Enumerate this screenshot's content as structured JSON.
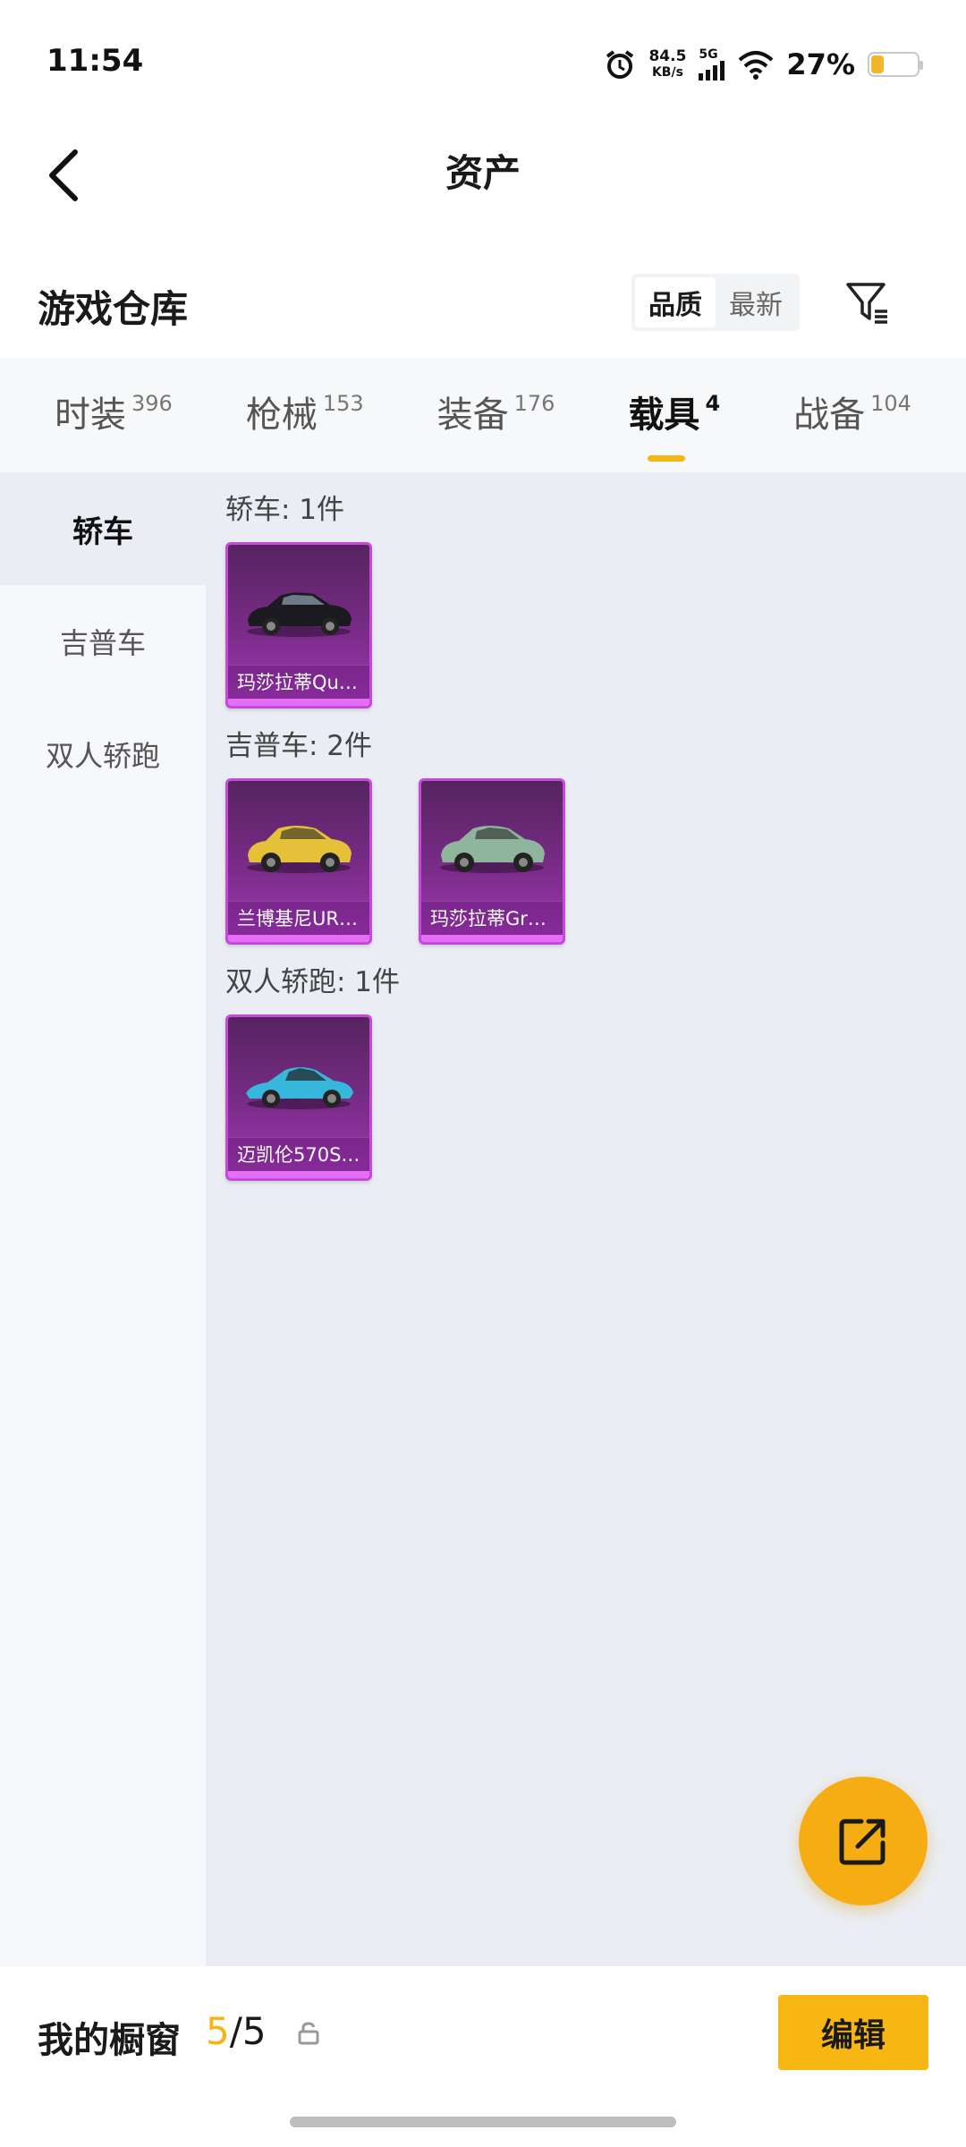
{
  "status_bar": {
    "time": "11:54",
    "speed_value": "84.5",
    "speed_unit": "KB/s",
    "network": "5G",
    "battery_percent": "27%",
    "battery_level": 0.27
  },
  "header": {
    "title": "资产"
  },
  "warehouse": {
    "title": "游戏仓库",
    "sort_options": [
      "品质",
      "最新"
    ],
    "sort_selected": "品质"
  },
  "tabs": [
    {
      "label": "时装",
      "count": "396"
    },
    {
      "label": "枪械",
      "count": "153"
    },
    {
      "label": "装备",
      "count": "176"
    },
    {
      "label": "载具",
      "count": "4",
      "active": true
    },
    {
      "label": "战备",
      "count": "104"
    }
  ],
  "left_nav": [
    {
      "label": "轿车",
      "active": true
    },
    {
      "label": "吉普车"
    },
    {
      "label": "双人轿跑"
    }
  ],
  "sections": [
    {
      "title": "轿车: 1件",
      "items": [
        {
          "name": "玛莎拉蒂Qu…",
          "car_color": "#1b1b1f"
        }
      ]
    },
    {
      "title": "吉普车: 2件",
      "items": [
        {
          "name": "兰博基尼UR…",
          "car_color": "#e5c139"
        },
        {
          "name": "玛莎拉蒂Gr…",
          "car_color": "#8fb59c"
        }
      ]
    },
    {
      "title": "双人轿跑: 1件",
      "items": [
        {
          "name": "迈凯伦570S…",
          "car_color": "#38b7dc"
        }
      ]
    }
  ],
  "bottom_bar": {
    "showcase_label": "我的橱窗",
    "showcase_current": "5",
    "showcase_separator": "/",
    "showcase_total": "5",
    "edit_label": "编辑"
  },
  "colors": {
    "accent": "#f7b614",
    "card_border": "#c54ad6",
    "card_bg": "#7a2c89"
  }
}
